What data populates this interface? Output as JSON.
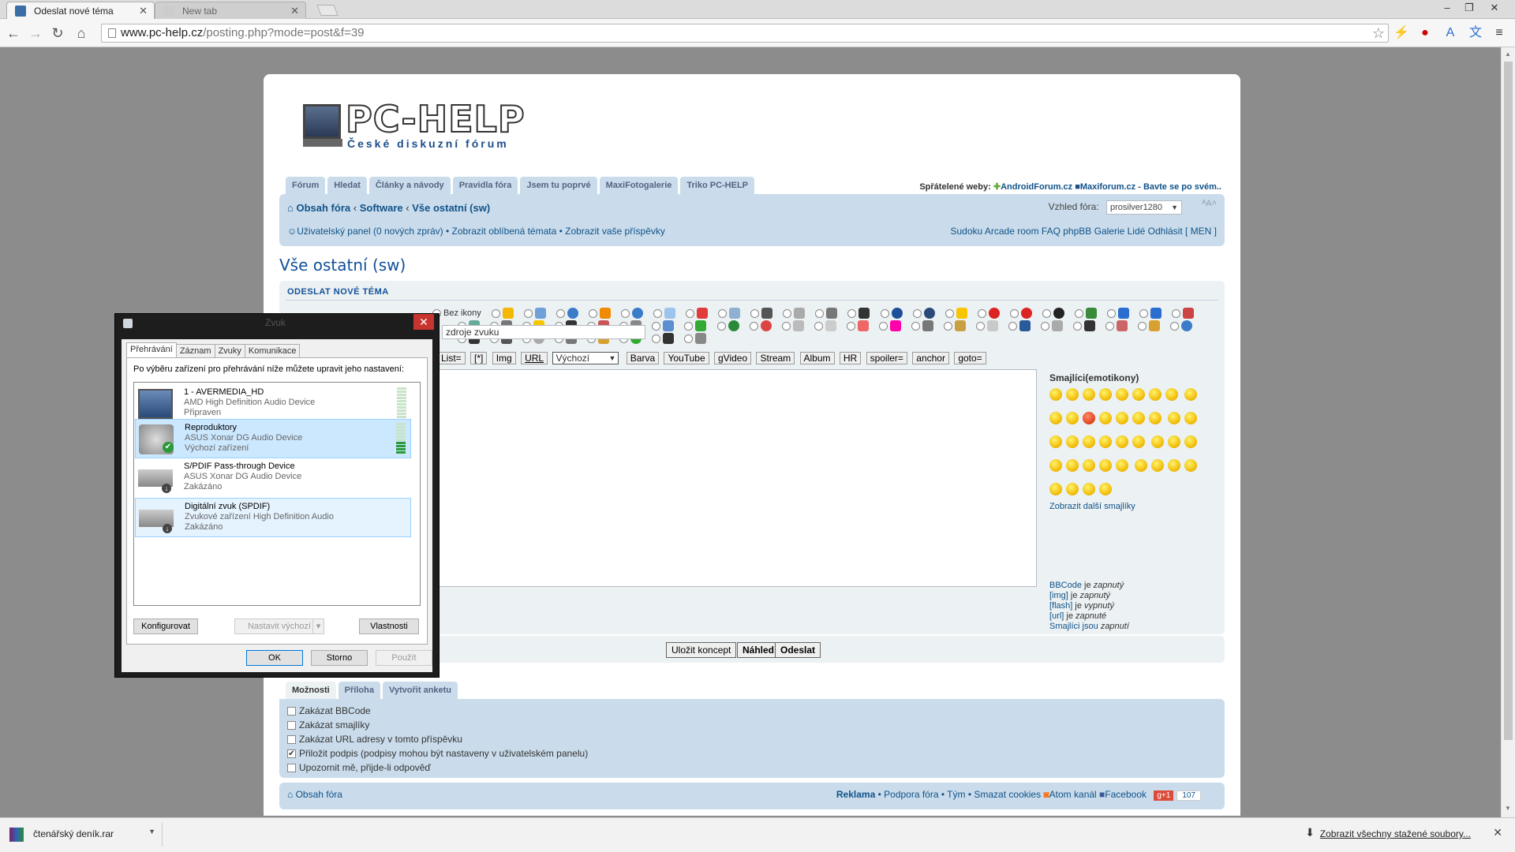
{
  "browser": {
    "tabs": [
      {
        "title": "Odeslat nové téma",
        "active": true
      },
      {
        "title": "New tab",
        "active": false
      }
    ],
    "url_host": "www.pc-help.cz",
    "url_path": "/posting.php?mode=post&f=39"
  },
  "site": {
    "logo_title": "PC-HELP",
    "logo_subtitle": "České diskuzní fórum",
    "nav_tabs": [
      "Fórum",
      "Hledat",
      "Články a návody",
      "Pravidla fóra",
      "Jsem tu poprvé",
      "MaxiFotogalerie",
      "Triko PC-HELP"
    ],
    "friends_label": "Spřátelené weby:",
    "friends_links": [
      "AndroidForum.cz",
      "Maxiforum.cz - Bavte se po svém.."
    ],
    "breadcrumb": [
      "Obsah fóra",
      "Software",
      "Vše ostatní (sw)"
    ],
    "style_label": "Vzhled fóra:",
    "style_value": "prosilver1280",
    "user_links": "Uživatelský panel (0 nových zpráv) • Zobrazit oblíbená témata • Zobrazit vaše příspěvky",
    "right_links": "Sudoku  Arcade room  FAQ phpBB  Galerie  Lidé  Odhlásit [ MEN ]"
  },
  "post": {
    "page_title": "Vše ostatní (sw)",
    "section_title": "ODESLAT NOVÉ TÉMA",
    "no_icon_label": "Bez ikony",
    "subject_value": "zdroje zvuku",
    "toolbar": [
      "List=",
      "[*]",
      "Img",
      "URL"
    ],
    "font_select": "Výchozí",
    "toolbar2": [
      "Barva",
      "YouTube",
      "gVideo",
      "Stream",
      "Album",
      "HR",
      "spoiler=",
      "anchor",
      "goto="
    ],
    "smilies_title": "Smajlíci(emotikony)",
    "more_smilies": "Zobrazit další smajlíky",
    "bbinfo": [
      {
        "label": "BBCode",
        "state": "zapnutý"
      },
      {
        "label": "[img]",
        "state": "zapnutý"
      },
      {
        "label": "[flash]",
        "state": "vypnutý"
      },
      {
        "label": "[url]",
        "state": "zapnuté"
      },
      {
        "label": "Smajlíci jsou",
        "state": "zapnutí"
      }
    ],
    "bb_je": "je",
    "buttons": {
      "save_draft": "Uložit koncept",
      "preview": "Náhled",
      "submit": "Odeslat"
    },
    "option_tabs": [
      "Možnosti",
      "Příloha",
      "Vytvořit anketu"
    ],
    "options": [
      {
        "label": "Zakázat BBCode",
        "checked": false
      },
      {
        "label": "Zakázat smajlíky",
        "checked": false
      },
      {
        "label": "Zakázat URL adresy v tomto příspěvku",
        "checked": false
      },
      {
        "label": "Přiložit podpis (podpisy mohou být nastaveny v uživatelském panelu)",
        "checked": true
      },
      {
        "label": "Upozornit mě, přijde-li odpověď",
        "checked": false
      }
    ]
  },
  "footer": {
    "left": "Obsah fóra",
    "reklama": "Reklama",
    "links": "• Podpora fóra • Tým • Smazat cookies",
    "atom": "Atom kanál",
    "facebook": "Facebook",
    "gplus": "g+1",
    "gcount": "107"
  },
  "dialog": {
    "title": "Zvuk",
    "tabs": [
      "Přehrávání",
      "Záznam",
      "Zvuky",
      "Komunikace"
    ],
    "instruction": "Po výběru zařízení pro přehrávání níže můžete upravit jeho nastavení:",
    "devices": [
      {
        "name": "1 - AVERMEDIA_HD",
        "desc": "AMD High Definition Audio Device",
        "status": "Připraven",
        "level": 0
      },
      {
        "name": "Reproduktory",
        "desc": "ASUS Xonar DG Audio Device",
        "status": "Výchozí zařízení",
        "level": 0.35
      },
      {
        "name": "S/PDIF Pass-through Device",
        "desc": "ASUS Xonar DG Audio Device",
        "status": "Zakázáno",
        "level": 0
      },
      {
        "name": "Digitální zvuk (SPDIF)",
        "desc": "Zvukové zařízení High Definition Audio",
        "status": "Zakázáno",
        "level": 0
      }
    ],
    "btn_configure": "Konfigurovat",
    "btn_set_default": "Nastavit výchozí",
    "btn_properties": "Vlastnosti",
    "btn_ok": "OK",
    "btn_cancel": "Storno",
    "btn_apply": "Použít"
  },
  "downloads": {
    "file": "čtenářský deník.rar",
    "show_all": "Zobrazit všechny stažené soubory..."
  },
  "colors": {
    "forum_blue": "#105289",
    "panel": "#cadceb",
    "dialog_select": "#cce8ff"
  }
}
